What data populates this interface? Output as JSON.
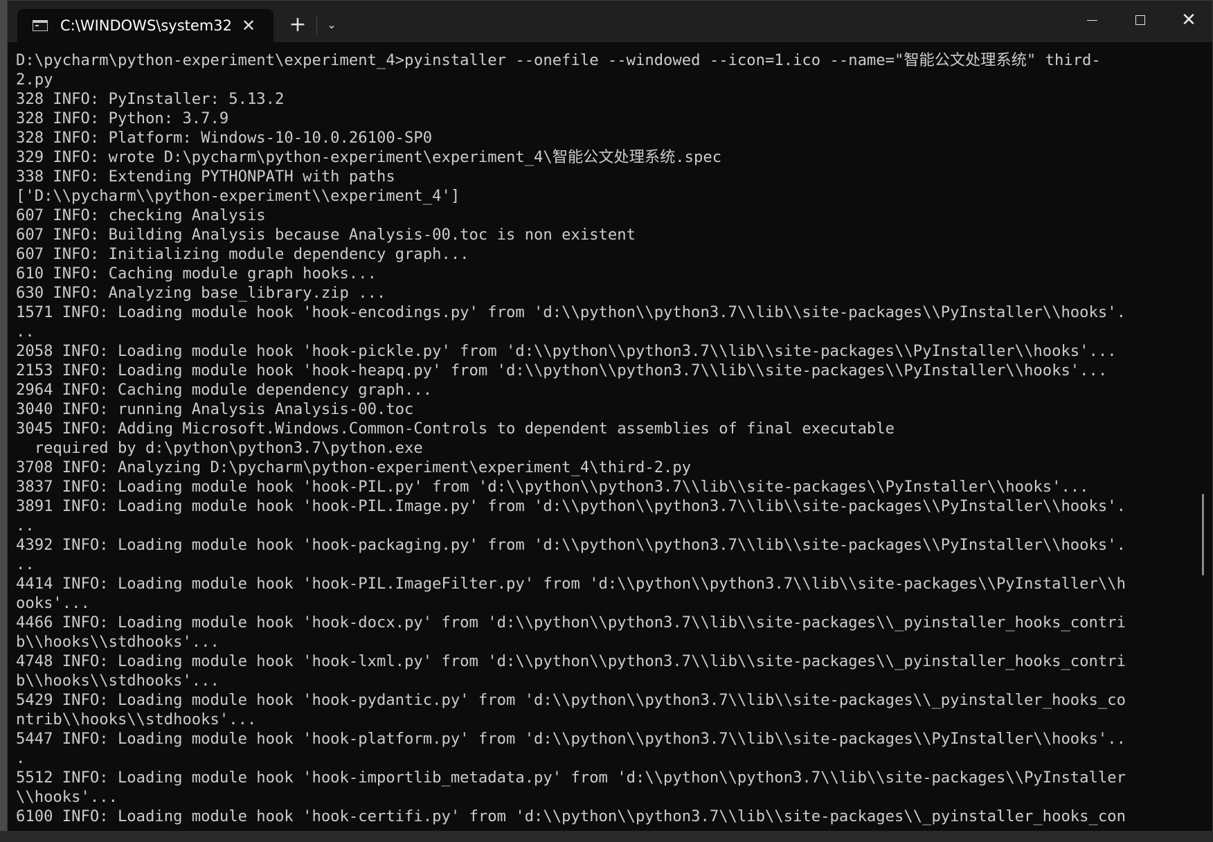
{
  "tab": {
    "title": "C:\\WINDOWS\\system32",
    "close_glyph": "✕",
    "new_tab_glyph": "+",
    "dropdown_glyph": "⌄"
  },
  "window_controls": {
    "close_glyph": "✕"
  },
  "icons": [
    "cmd-icon",
    "close-icon",
    "plus-icon",
    "chevron-down-icon",
    "minimize-icon",
    "maximize-icon",
    "close-window-icon"
  ],
  "colors": {
    "console_bg": "#0c0c0c",
    "console_text": "#cccccc",
    "titlebar_bg": "#202020"
  },
  "console_lines": [
    "D:\\pycharm\\python-experiment\\experiment_4>pyinstaller --onefile --windowed --icon=1.ico --name=\"智能公文处理系统\" third-",
    "2.py",
    "328 INFO: PyInstaller: 5.13.2",
    "328 INFO: Python: 3.7.9",
    "328 INFO: Platform: Windows-10-10.0.26100-SP0",
    "329 INFO: wrote D:\\pycharm\\python-experiment\\experiment_4\\智能公文处理系统.spec",
    "338 INFO: Extending PYTHONPATH with paths",
    "['D:\\\\pycharm\\\\python-experiment\\\\experiment_4']",
    "607 INFO: checking Analysis",
    "607 INFO: Building Analysis because Analysis-00.toc is non existent",
    "607 INFO: Initializing module dependency graph...",
    "610 INFO: Caching module graph hooks...",
    "630 INFO: Analyzing base_library.zip ...",
    "1571 INFO: Loading module hook 'hook-encodings.py' from 'd:\\\\python\\\\python3.7\\\\lib\\\\site-packages\\\\PyInstaller\\\\hooks'.",
    "..",
    "2058 INFO: Loading module hook 'hook-pickle.py' from 'd:\\\\python\\\\python3.7\\\\lib\\\\site-packages\\\\PyInstaller\\\\hooks'...",
    "2153 INFO: Loading module hook 'hook-heapq.py' from 'd:\\\\python\\\\python3.7\\\\lib\\\\site-packages\\\\PyInstaller\\\\hooks'...",
    "2964 INFO: Caching module dependency graph...",
    "3040 INFO: running Analysis Analysis-00.toc",
    "3045 INFO: Adding Microsoft.Windows.Common-Controls to dependent assemblies of final executable",
    "  required by d:\\python\\python3.7\\python.exe",
    "3708 INFO: Analyzing D:\\pycharm\\python-experiment\\experiment_4\\third-2.py",
    "3837 INFO: Loading module hook 'hook-PIL.py' from 'd:\\\\python\\\\python3.7\\\\lib\\\\site-packages\\\\PyInstaller\\\\hooks'...",
    "3891 INFO: Loading module hook 'hook-PIL.Image.py' from 'd:\\\\python\\\\python3.7\\\\lib\\\\site-packages\\\\PyInstaller\\\\hooks'.",
    "..",
    "4392 INFO: Loading module hook 'hook-packaging.py' from 'd:\\\\python\\\\python3.7\\\\lib\\\\site-packages\\\\PyInstaller\\\\hooks'.",
    "..",
    "4414 INFO: Loading module hook 'hook-PIL.ImageFilter.py' from 'd:\\\\python\\\\python3.7\\\\lib\\\\site-packages\\\\PyInstaller\\\\h",
    "ooks'...",
    "4466 INFO: Loading module hook 'hook-docx.py' from 'd:\\\\python\\\\python3.7\\\\lib\\\\site-packages\\\\_pyinstaller_hooks_contri",
    "b\\\\hooks\\\\stdhooks'...",
    "4748 INFO: Loading module hook 'hook-lxml.py' from 'd:\\\\python\\\\python3.7\\\\lib\\\\site-packages\\\\_pyinstaller_hooks_contri",
    "b\\\\hooks\\\\stdhooks'...",
    "5429 INFO: Loading module hook 'hook-pydantic.py' from 'd:\\\\python\\\\python3.7\\\\lib\\\\site-packages\\\\_pyinstaller_hooks_co",
    "ntrib\\\\hooks\\\\stdhooks'...",
    "5447 INFO: Loading module hook 'hook-platform.py' from 'd:\\\\python\\\\python3.7\\\\lib\\\\site-packages\\\\PyInstaller\\\\hooks'..",
    ".",
    "5512 INFO: Loading module hook 'hook-importlib_metadata.py' from 'd:\\\\python\\\\python3.7\\\\lib\\\\site-packages\\\\PyInstaller",
    "\\\\hooks'...",
    "6100 INFO: Loading module hook 'hook-certifi.py' from 'd:\\\\python\\\\python3.7\\\\lib\\\\site-packages\\\\_pyinstaller_hooks_con"
  ]
}
